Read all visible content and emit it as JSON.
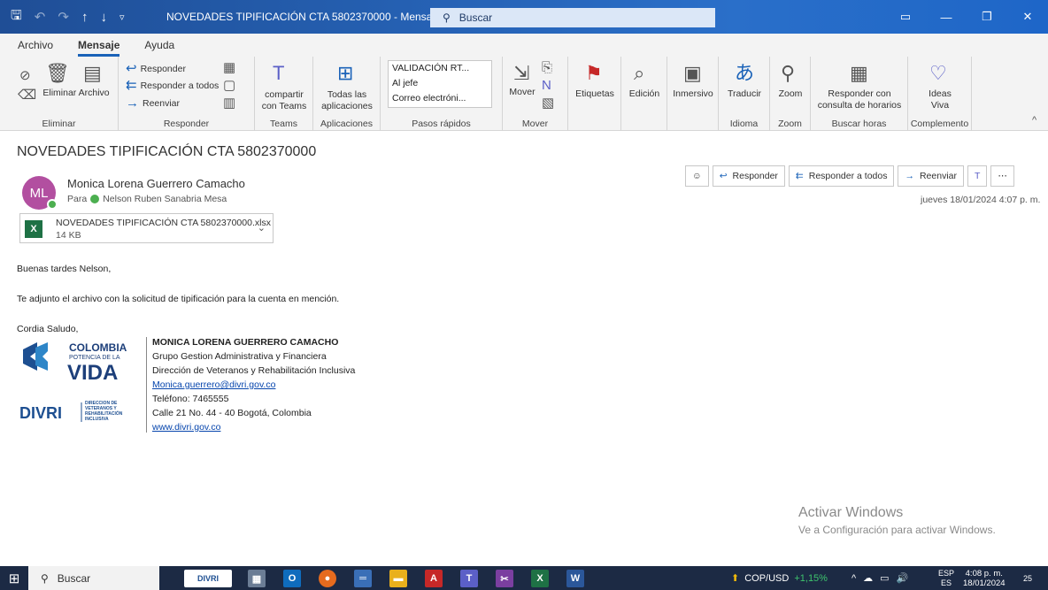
{
  "window": {
    "title": "NOVEDADES TIPIFICACIÓN CTA 5802370000 - Mensaje (HT...",
    "search_placeholder": "Buscar",
    "accent": "#1f4e96"
  },
  "menu": {
    "tabs": [
      "Archivo",
      "Mensaje",
      "Ayuda"
    ],
    "active": "Mensaje"
  },
  "ribbon": {
    "eliminar": {
      "label": "Eliminar",
      "archivo_label": "Eliminar Archivo"
    },
    "responder": {
      "label": "Responder",
      "reply": "Responder",
      "reply_all": "Responder a todos",
      "forward": "Reenviar"
    },
    "teams": {
      "label": "Teams",
      "share": "compartir con Teams"
    },
    "apps": {
      "label": "Aplicaciones",
      "all": "Todas las aplicaciones"
    },
    "quick_steps": {
      "label": "Pasos rápidos",
      "items": [
        "VALIDACIÓN RT...",
        "Al jefe",
        "Correo electróni..."
      ]
    },
    "mover": {
      "label": "Mover",
      "move": "Mover"
    },
    "etiquetas": {
      "label": "Etiquetas"
    },
    "edicion": {
      "label": "Edición"
    },
    "inmersivo": {
      "label": "Inmersivo"
    },
    "idioma": {
      "label": "Idioma",
      "translate": "Traducir"
    },
    "zoom": {
      "label": "Zoom",
      "zoom": "Zoom"
    },
    "horas": {
      "label": "Buscar horas",
      "reply_sched": "Responder con consulta de horarios"
    },
    "complemento": {
      "label": "Complemento",
      "ideas": "Ideas Viva"
    }
  },
  "message": {
    "subject": "NOVEDADES TIPIFICACIÓN  CTA 5802370000",
    "avatar_initials": "ML",
    "sender": "Monica Lorena Guerrero Camacho",
    "to_label": "Para",
    "to_name": "Nelson Ruben Sanabria Mesa",
    "datetime": "jueves 18/01/2024 4:07 p. m.",
    "attachment": {
      "name": "NOVEDADES TIPIFICACIÓN  CTA 5802370000.xlsx",
      "size": "14 KB"
    },
    "actions": {
      "reply": "Responder",
      "reply_all": "Responder a todos",
      "forward": "Reenviar"
    },
    "body": [
      "Buenas tardes Nelson,",
      "Te adjunto el archivo con la solicitud de tipificación para la cuenta en mención.",
      "Cordia Saludo,"
    ],
    "signature": {
      "name": "MONICA LORENA GUERRERO CAMACHO",
      "group": "Grupo Gestion Administrativa y Financiera",
      "direction": "Dirección de Veteranos y Rehabilitación Inclusiva",
      "email": "Monica.guerrero@divri.gov.co",
      "phone": "Teléfono: 7465555",
      "address": "Calle 21 No. 44 - 40 Bogotá, Colombia",
      "web": "www.divri.gov.co"
    },
    "logo": {
      "line1": "COLOMBIA",
      "line2": "POTENCIA DE LA",
      "line3": "VIDA",
      "divri": "DIVRI",
      "divri_sub": "DIRECCIÓN DE VETERANOS Y REHABILITACIÓN INCLUSIVA"
    }
  },
  "watermark": {
    "line1": "Activar Windows",
    "line2": "Ve a Configuración para activar Windows."
  },
  "taskbar": {
    "search": "Buscar",
    "currency": "COP/USD",
    "currency_change": "+1,15%",
    "lang1": "ESP",
    "lang2": "ES",
    "time": "4:08 p. m.",
    "date": "18/01/2024",
    "notif_count": "25"
  }
}
